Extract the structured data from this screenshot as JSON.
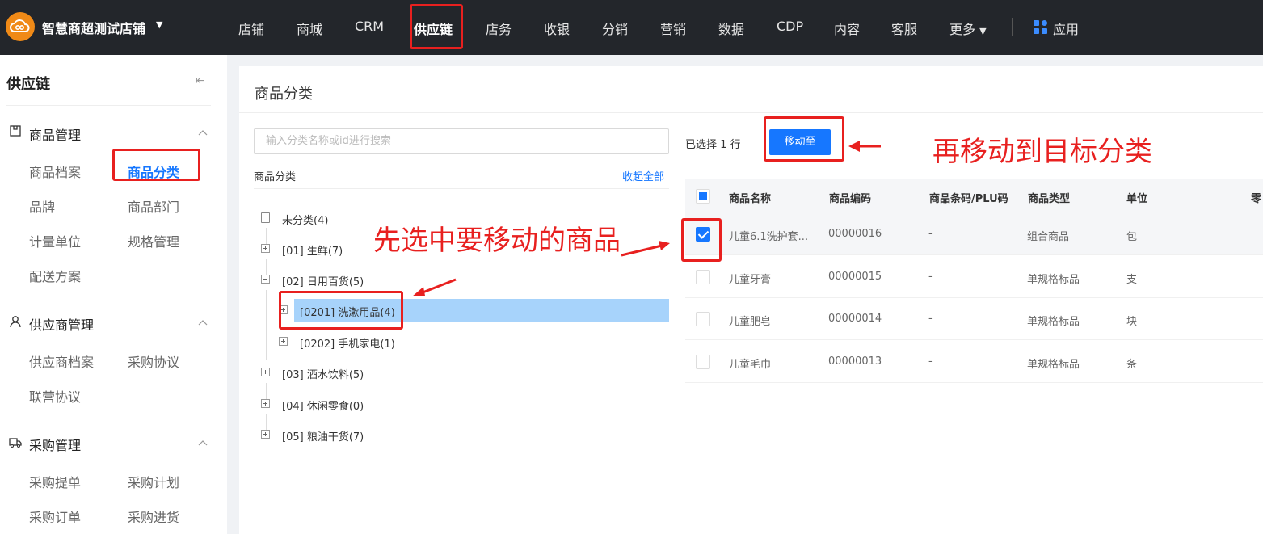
{
  "topbar": {
    "store_name": "智慧商超测试店铺",
    "nav": [
      "店铺",
      "商城",
      "CRM",
      "供应链",
      "店务",
      "收银",
      "分销",
      "营销",
      "数据",
      "CDP",
      "内容",
      "客服",
      "更多"
    ],
    "active_nav": "供应链",
    "apps_label": "应用"
  },
  "sidebar": {
    "title": "供应链",
    "groups": [
      {
        "label": "商品管理",
        "items": [
          "商品档案",
          "商品分类",
          "品牌",
          "商品部门",
          "计量单位",
          "规格管理",
          "配送方案"
        ]
      },
      {
        "label": "供应商管理",
        "items": [
          "供应商档案",
          "采购协议",
          "联营协议"
        ]
      },
      {
        "label": "采购管理",
        "items": [
          "采购提单",
          "采购计划",
          "采购订单",
          "采购进货"
        ]
      }
    ],
    "active_item": "商品分类"
  },
  "main": {
    "title": "商品分类",
    "search_placeholder": "输入分类名称或id进行搜索",
    "tree_header": "商品分类",
    "collapse_all": "收起全部",
    "tree": [
      {
        "label": "未分类(4)"
      },
      {
        "label": "[01] 生鲜(7)"
      },
      {
        "label": "[02] 日用百货(5)"
      },
      {
        "label": "[0201] 洗漱用品(4)",
        "selected": true
      },
      {
        "label": "[0202] 手机家电(1)"
      },
      {
        "label": "[03] 酒水饮料(5)"
      },
      {
        "label": "[04] 休闲零食(0)"
      },
      {
        "label": "[05] 粮油干货(7)"
      }
    ],
    "selected_info": "已选择 1 行",
    "move_button": "移动至"
  },
  "table": {
    "columns": [
      "商品名称",
      "商品编码",
      "商品条码/PLU码",
      "商品类型",
      "单位",
      "零"
    ],
    "rows": [
      {
        "name": "儿童6.1洗护套...",
        "code": "00000016",
        "barcode": "-",
        "type": "组合商品",
        "unit": "包",
        "checked": true
      },
      {
        "name": "儿童牙膏",
        "code": "00000015",
        "barcode": "-",
        "type": "单规格标品",
        "unit": "支",
        "checked": false
      },
      {
        "name": "儿童肥皂",
        "code": "00000014",
        "barcode": "-",
        "type": "单规格标品",
        "unit": "块",
        "checked": false
      },
      {
        "name": "儿童毛巾",
        "code": "00000013",
        "barcode": "-",
        "type": "单规格标品",
        "unit": "条",
        "checked": false
      }
    ]
  },
  "annotations": {
    "select_goods": "先选中要移动的商品",
    "move_to_target": "再移动到目标分类",
    "color": "#e8201f"
  },
  "colors": {
    "accent": "#1677ff",
    "topbar": "#23262b",
    "logo": "#f08a17",
    "tree_selected": "#a7d3fb"
  }
}
